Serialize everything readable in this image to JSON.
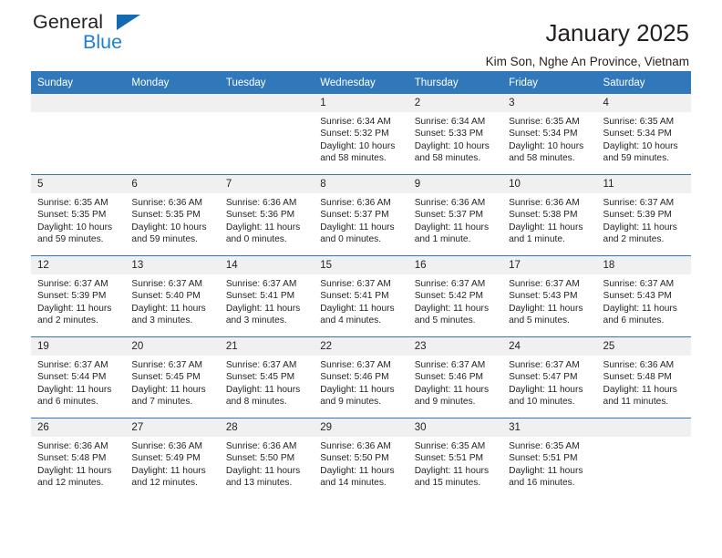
{
  "brand": {
    "name_part1": "General",
    "name_part2": "Blue",
    "accent_color": "#1f7fd0",
    "flag_color": "#156bb1"
  },
  "header": {
    "title": "January 2025",
    "subtitle": "Kim Son, Nghe An Province, Vietnam"
  },
  "calendar": {
    "header_bg": "#3178ba",
    "daynum_bg": "#f0f0f0",
    "weekday_headers": [
      "Sunday",
      "Monday",
      "Tuesday",
      "Wednesday",
      "Thursday",
      "Friday",
      "Saturday"
    ],
    "weeks": [
      [
        {
          "day": "",
          "blank": true,
          "sunrise": "",
          "sunset": "",
          "daylight1": "",
          "daylight2": ""
        },
        {
          "day": "",
          "blank": true,
          "sunrise": "",
          "sunset": "",
          "daylight1": "",
          "daylight2": ""
        },
        {
          "day": "",
          "blank": true,
          "sunrise": "",
          "sunset": "",
          "daylight1": "",
          "daylight2": ""
        },
        {
          "day": "1",
          "blank": false,
          "sunrise": "Sunrise: 6:34 AM",
          "sunset": "Sunset: 5:32 PM",
          "daylight1": "Daylight: 10 hours",
          "daylight2": "and 58 minutes."
        },
        {
          "day": "2",
          "blank": false,
          "sunrise": "Sunrise: 6:34 AM",
          "sunset": "Sunset: 5:33 PM",
          "daylight1": "Daylight: 10 hours",
          "daylight2": "and 58 minutes."
        },
        {
          "day": "3",
          "blank": false,
          "sunrise": "Sunrise: 6:35 AM",
          "sunset": "Sunset: 5:34 PM",
          "daylight1": "Daylight: 10 hours",
          "daylight2": "and 58 minutes."
        },
        {
          "day": "4",
          "blank": false,
          "sunrise": "Sunrise: 6:35 AM",
          "sunset": "Sunset: 5:34 PM",
          "daylight1": "Daylight: 10 hours",
          "daylight2": "and 59 minutes."
        }
      ],
      [
        {
          "day": "5",
          "blank": false,
          "sunrise": "Sunrise: 6:35 AM",
          "sunset": "Sunset: 5:35 PM",
          "daylight1": "Daylight: 10 hours",
          "daylight2": "and 59 minutes."
        },
        {
          "day": "6",
          "blank": false,
          "sunrise": "Sunrise: 6:36 AM",
          "sunset": "Sunset: 5:35 PM",
          "daylight1": "Daylight: 10 hours",
          "daylight2": "and 59 minutes."
        },
        {
          "day": "7",
          "blank": false,
          "sunrise": "Sunrise: 6:36 AM",
          "sunset": "Sunset: 5:36 PM",
          "daylight1": "Daylight: 11 hours",
          "daylight2": "and 0 minutes."
        },
        {
          "day": "8",
          "blank": false,
          "sunrise": "Sunrise: 6:36 AM",
          "sunset": "Sunset: 5:37 PM",
          "daylight1": "Daylight: 11 hours",
          "daylight2": "and 0 minutes."
        },
        {
          "day": "9",
          "blank": false,
          "sunrise": "Sunrise: 6:36 AM",
          "sunset": "Sunset: 5:37 PM",
          "daylight1": "Daylight: 11 hours",
          "daylight2": "and 1 minute."
        },
        {
          "day": "10",
          "blank": false,
          "sunrise": "Sunrise: 6:36 AM",
          "sunset": "Sunset: 5:38 PM",
          "daylight1": "Daylight: 11 hours",
          "daylight2": "and 1 minute."
        },
        {
          "day": "11",
          "blank": false,
          "sunrise": "Sunrise: 6:37 AM",
          "sunset": "Sunset: 5:39 PM",
          "daylight1": "Daylight: 11 hours",
          "daylight2": "and 2 minutes."
        }
      ],
      [
        {
          "day": "12",
          "blank": false,
          "sunrise": "Sunrise: 6:37 AM",
          "sunset": "Sunset: 5:39 PM",
          "daylight1": "Daylight: 11 hours",
          "daylight2": "and 2 minutes."
        },
        {
          "day": "13",
          "blank": false,
          "sunrise": "Sunrise: 6:37 AM",
          "sunset": "Sunset: 5:40 PM",
          "daylight1": "Daylight: 11 hours",
          "daylight2": "and 3 minutes."
        },
        {
          "day": "14",
          "blank": false,
          "sunrise": "Sunrise: 6:37 AM",
          "sunset": "Sunset: 5:41 PM",
          "daylight1": "Daylight: 11 hours",
          "daylight2": "and 3 minutes."
        },
        {
          "day": "15",
          "blank": false,
          "sunrise": "Sunrise: 6:37 AM",
          "sunset": "Sunset: 5:41 PM",
          "daylight1": "Daylight: 11 hours",
          "daylight2": "and 4 minutes."
        },
        {
          "day": "16",
          "blank": false,
          "sunrise": "Sunrise: 6:37 AM",
          "sunset": "Sunset: 5:42 PM",
          "daylight1": "Daylight: 11 hours",
          "daylight2": "and 5 minutes."
        },
        {
          "day": "17",
          "blank": false,
          "sunrise": "Sunrise: 6:37 AM",
          "sunset": "Sunset: 5:43 PM",
          "daylight1": "Daylight: 11 hours",
          "daylight2": "and 5 minutes."
        },
        {
          "day": "18",
          "blank": false,
          "sunrise": "Sunrise: 6:37 AM",
          "sunset": "Sunset: 5:43 PM",
          "daylight1": "Daylight: 11 hours",
          "daylight2": "and 6 minutes."
        }
      ],
      [
        {
          "day": "19",
          "blank": false,
          "sunrise": "Sunrise: 6:37 AM",
          "sunset": "Sunset: 5:44 PM",
          "daylight1": "Daylight: 11 hours",
          "daylight2": "and 6 minutes."
        },
        {
          "day": "20",
          "blank": false,
          "sunrise": "Sunrise: 6:37 AM",
          "sunset": "Sunset: 5:45 PM",
          "daylight1": "Daylight: 11 hours",
          "daylight2": "and 7 minutes."
        },
        {
          "day": "21",
          "blank": false,
          "sunrise": "Sunrise: 6:37 AM",
          "sunset": "Sunset: 5:45 PM",
          "daylight1": "Daylight: 11 hours",
          "daylight2": "and 8 minutes."
        },
        {
          "day": "22",
          "blank": false,
          "sunrise": "Sunrise: 6:37 AM",
          "sunset": "Sunset: 5:46 PM",
          "daylight1": "Daylight: 11 hours",
          "daylight2": "and 9 minutes."
        },
        {
          "day": "23",
          "blank": false,
          "sunrise": "Sunrise: 6:37 AM",
          "sunset": "Sunset: 5:46 PM",
          "daylight1": "Daylight: 11 hours",
          "daylight2": "and 9 minutes."
        },
        {
          "day": "24",
          "blank": false,
          "sunrise": "Sunrise: 6:37 AM",
          "sunset": "Sunset: 5:47 PM",
          "daylight1": "Daylight: 11 hours",
          "daylight2": "and 10 minutes."
        },
        {
          "day": "25",
          "blank": false,
          "sunrise": "Sunrise: 6:36 AM",
          "sunset": "Sunset: 5:48 PM",
          "daylight1": "Daylight: 11 hours",
          "daylight2": "and 11 minutes."
        }
      ],
      [
        {
          "day": "26",
          "blank": false,
          "sunrise": "Sunrise: 6:36 AM",
          "sunset": "Sunset: 5:48 PM",
          "daylight1": "Daylight: 11 hours",
          "daylight2": "and 12 minutes."
        },
        {
          "day": "27",
          "blank": false,
          "sunrise": "Sunrise: 6:36 AM",
          "sunset": "Sunset: 5:49 PM",
          "daylight1": "Daylight: 11 hours",
          "daylight2": "and 12 minutes."
        },
        {
          "day": "28",
          "blank": false,
          "sunrise": "Sunrise: 6:36 AM",
          "sunset": "Sunset: 5:50 PM",
          "daylight1": "Daylight: 11 hours",
          "daylight2": "and 13 minutes."
        },
        {
          "day": "29",
          "blank": false,
          "sunrise": "Sunrise: 6:36 AM",
          "sunset": "Sunset: 5:50 PM",
          "daylight1": "Daylight: 11 hours",
          "daylight2": "and 14 minutes."
        },
        {
          "day": "30",
          "blank": false,
          "sunrise": "Sunrise: 6:35 AM",
          "sunset": "Sunset: 5:51 PM",
          "daylight1": "Daylight: 11 hours",
          "daylight2": "and 15 minutes."
        },
        {
          "day": "31",
          "blank": false,
          "sunrise": "Sunrise: 6:35 AM",
          "sunset": "Sunset: 5:51 PM",
          "daylight1": "Daylight: 11 hours",
          "daylight2": "and 16 minutes."
        },
        {
          "day": "",
          "blank": true,
          "sunrise": "",
          "sunset": "",
          "daylight1": "",
          "daylight2": ""
        }
      ]
    ]
  }
}
